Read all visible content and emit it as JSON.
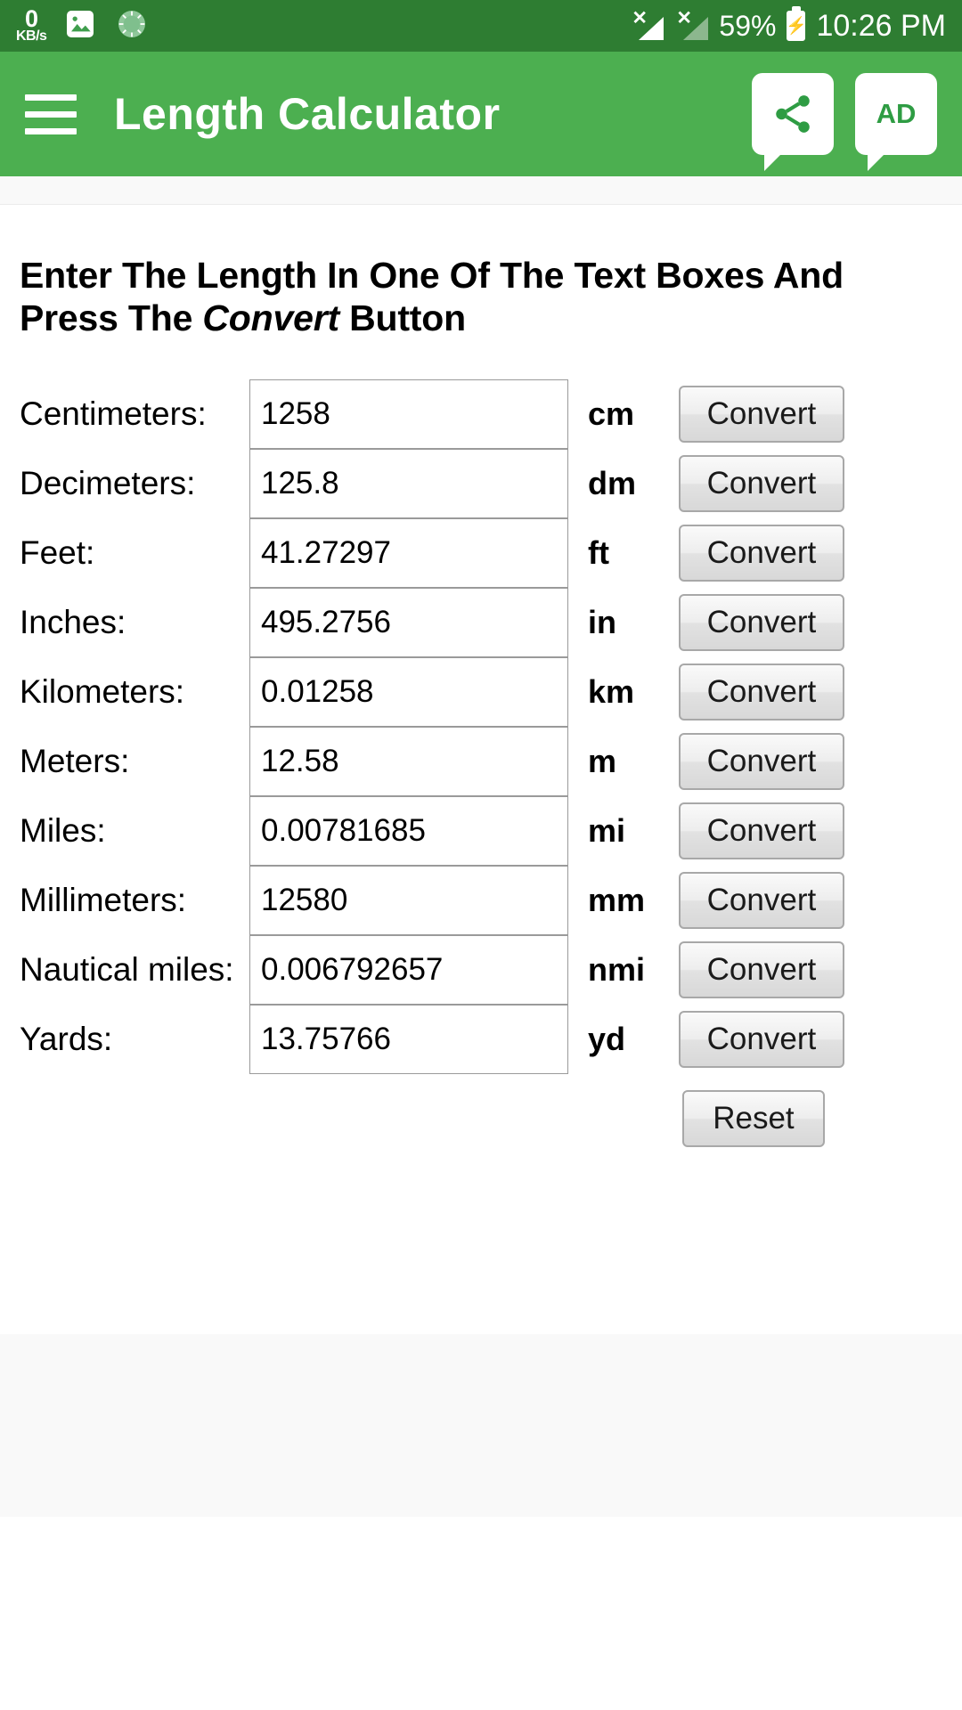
{
  "status_bar": {
    "network_speed_value": "0",
    "network_speed_unit": "KB/s",
    "icons": [
      "image-icon",
      "sun-brightness-icon",
      "signal-no-service-icon",
      "signal-no-service-faded-icon"
    ],
    "signal_no_service_mark": "✕",
    "battery_percent": "59%",
    "clock": "10:26 PM",
    "background_color": "#2e7d32"
  },
  "app_bar": {
    "menu_icon": "hamburger-menu-icon",
    "title": "Length Calculator",
    "share_icon": "share-icon",
    "ad_label": "AD",
    "background_color": "#4caf50",
    "accent_color": "#2e9c43"
  },
  "instructions": {
    "part1": "Enter The Length In One Of The Text Boxes And Press The ",
    "emphasis": "Convert",
    "part2": " Button"
  },
  "converter": {
    "convert_label": "Convert",
    "reset_label": "Reset",
    "input_placeholder": "",
    "rows": [
      {
        "label": "Centimeters:",
        "value": "1258",
        "unit": "cm"
      },
      {
        "label": "Decimeters:",
        "value": "125.8",
        "unit": "dm"
      },
      {
        "label": "Feet:",
        "value": "41.27297",
        "unit": "ft"
      },
      {
        "label": "Inches:",
        "value": "495.2756",
        "unit": "in"
      },
      {
        "label": "Kilometers:",
        "value": "0.01258",
        "unit": "km"
      },
      {
        "label": "Meters:",
        "value": "12.58",
        "unit": "m"
      },
      {
        "label": "Miles:",
        "value": "0.00781685",
        "unit": "mi"
      },
      {
        "label": "Millimeters:",
        "value": "12580",
        "unit": "mm"
      },
      {
        "label": "Nautical miles:",
        "value": "0.006792657",
        "unit": "nmi"
      },
      {
        "label": "Yards:",
        "value": "13.75766",
        "unit": "yd"
      }
    ]
  }
}
